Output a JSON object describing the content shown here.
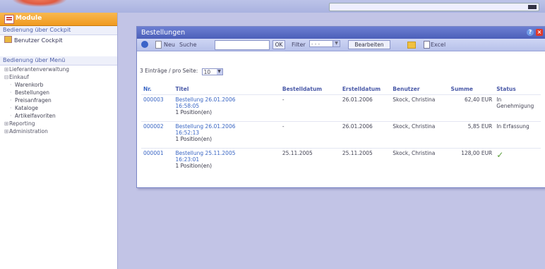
{
  "sidebar": {
    "module_title": "Module",
    "cockpit_section": "Bedienung über Cockpit",
    "cockpit_link": "Benutzer Cockpit",
    "menu_section": "Bedienung über Menü",
    "tree": [
      {
        "label": "Lieferantenverwaltung",
        "toggle": "⊞",
        "level": 0
      },
      {
        "label": "Einkauf",
        "toggle": "⊟",
        "level": 0
      },
      {
        "label": "Warenkorb",
        "level": 1
      },
      {
        "label": "Bestellungen",
        "level": 1
      },
      {
        "label": "Preisanfragen",
        "level": 1
      },
      {
        "label": "Kataloge",
        "level": 1
      },
      {
        "label": "Artikelfavoriten",
        "level": 1
      },
      {
        "label": "Reporting",
        "toggle": "⊞",
        "level": 0
      },
      {
        "label": "Administration",
        "toggle": "⊞",
        "level": 0
      }
    ]
  },
  "panel": {
    "title": "Bestellungen",
    "help_glyph": "?",
    "close_glyph": "×"
  },
  "toolbar": {
    "new_label": "Neu",
    "search_label": "Suche",
    "search_value": "",
    "ok_label": "OK",
    "filter_label": "Filter",
    "filter_value": "- - -",
    "edit_label": "Bearbeiten",
    "excel_label": "Excel"
  },
  "paging": {
    "text": "3 Einträge / pro Seite:",
    "per_page": "10"
  },
  "table": {
    "headers": {
      "nr": "Nr.",
      "titel": "Titel",
      "bestelldatum": "Bestelldatum",
      "erstelldatum": "Erstelldatum",
      "benutzer": "Benutzer",
      "summe": "Summe",
      "status": "Status"
    },
    "rows": [
      {
        "nr": "000003",
        "titel": "Bestellung 26.01.2006",
        "zeit": "16:58:05",
        "positionen": "1 Position(en)",
        "bestelldatum": "-",
        "erstelldatum": "26.01.2006",
        "benutzer": "Skock, Christina",
        "summe": "62,40 EUR",
        "status": "In Genehmigung"
      },
      {
        "nr": "000002",
        "titel": "Bestellung 26.01.2006",
        "zeit": "16:52:13",
        "positionen": "1 Position(en)",
        "bestelldatum": "-",
        "erstelldatum": "26.01.2006",
        "benutzer": "Skock, Christina",
        "summe": "5,85 EUR",
        "status": "In Erfassung"
      },
      {
        "nr": "000001",
        "titel": "Bestellung 25.11.2005",
        "zeit": "16:23:01",
        "positionen": "1 Position(en)",
        "bestelldatum": "25.11.2005",
        "erstelldatum": "25.11.2005",
        "benutzer": "Skock, Christina",
        "summe": "128,00 EUR",
        "status": "✓"
      }
    ]
  },
  "colors": {
    "background": "#c2c4e6",
    "title_bar": "#4c5fb9",
    "module_header": "#f09a20",
    "link": "#3a66c4",
    "status_check": "#5a9e3a"
  },
  "icons": [
    "home-icon",
    "module-icon",
    "refresh-icon",
    "new-document-icon",
    "folder-icon",
    "excel-icon",
    "help-icon",
    "close-icon",
    "checkmark-icon"
  ]
}
